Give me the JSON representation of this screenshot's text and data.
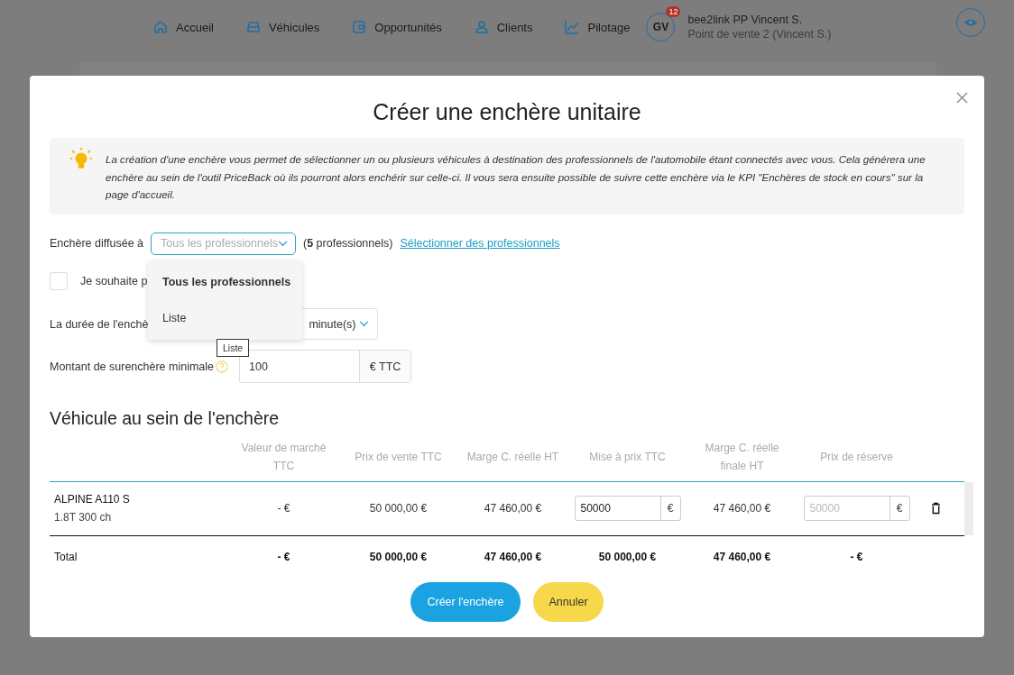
{
  "nav": {
    "items": [
      {
        "label": "Accueil",
        "kind": "home"
      },
      {
        "label": "Véhicules",
        "kind": "car"
      },
      {
        "label": "Opportunités",
        "kind": "wallet"
      },
      {
        "label": "Clients",
        "kind": "user"
      },
      {
        "label": "Pilotage",
        "kind": "chart"
      }
    ],
    "avatar": {
      "initials": "GV",
      "badge": "12"
    },
    "user": {
      "name": "bee2link PP Vincent S.",
      "site": "Point de vente 2 (Vincent S.)"
    }
  },
  "modal": {
    "title": "Créer une enchère unitaire",
    "info": "La création d'une enchère vous permet de sélectionner un ou plusieurs véhicules à destination des professionnels de l'automobile étant connectés avec vous. Cela générera une enchère au sein de l'outil PriceBack où ils pourront alors enchérir sur celle-ci. Il vous sera ensuite possible de suivre cette enchère via le KPI \"Enchères de stock en cours\" sur la page d'accueil.",
    "broadcast": {
      "label": "Enchère diffusée à",
      "placeholder": "Tous les professionnels",
      "count": "(**5** professionnels)",
      "link": "Sélectionner des professionnels",
      "options": [
        {
          "label": "Tous les professionnels",
          "selected": true
        },
        {
          "label": "Liste",
          "selected": false
        }
      ],
      "tooltip": "Liste"
    },
    "checkbox": {
      "label": "Je souhaite p",
      "checked": false
    },
    "duration": {
      "label": "La durée de l'enchè",
      "unit": "minute(s)"
    },
    "overbid": {
      "label": "Montant de surenchère minimale",
      "value": "100",
      "suffix": "€ TTC"
    },
    "section_title": "Véhicule au sein de l'enchère",
    "table": {
      "columns": [
        "Valeur de marché TTC",
        "Prix de vente TTC",
        "Marge C. réelle HT",
        "Mise à prix TTC",
        "Marge C. réelle finale HT",
        "Prix de réserve"
      ],
      "rows": [
        {
          "name": "ALPINE A110 S",
          "engine": "1.8T 300 ch",
          "market": "- €",
          "sale": "50 000,00 €",
          "margin": "47 460,00 €",
          "start_price": "50000",
          "currency": "€",
          "final_margin": "47 460,00 €",
          "reserve_placeholder": "50000",
          "reserve_currency": "€"
        }
      ],
      "total": [
        "Total",
        "- €",
        "50 000,00 €",
        "47 460,00 €",
        "50 000,00 €",
        "47 460,00 €",
        "- €"
      ]
    },
    "buttons": [
      {
        "label": "Créer l'enchère",
        "kind": "primary"
      },
      {
        "label": "Annuler",
        "kind": "secondary"
      }
    ]
  }
}
